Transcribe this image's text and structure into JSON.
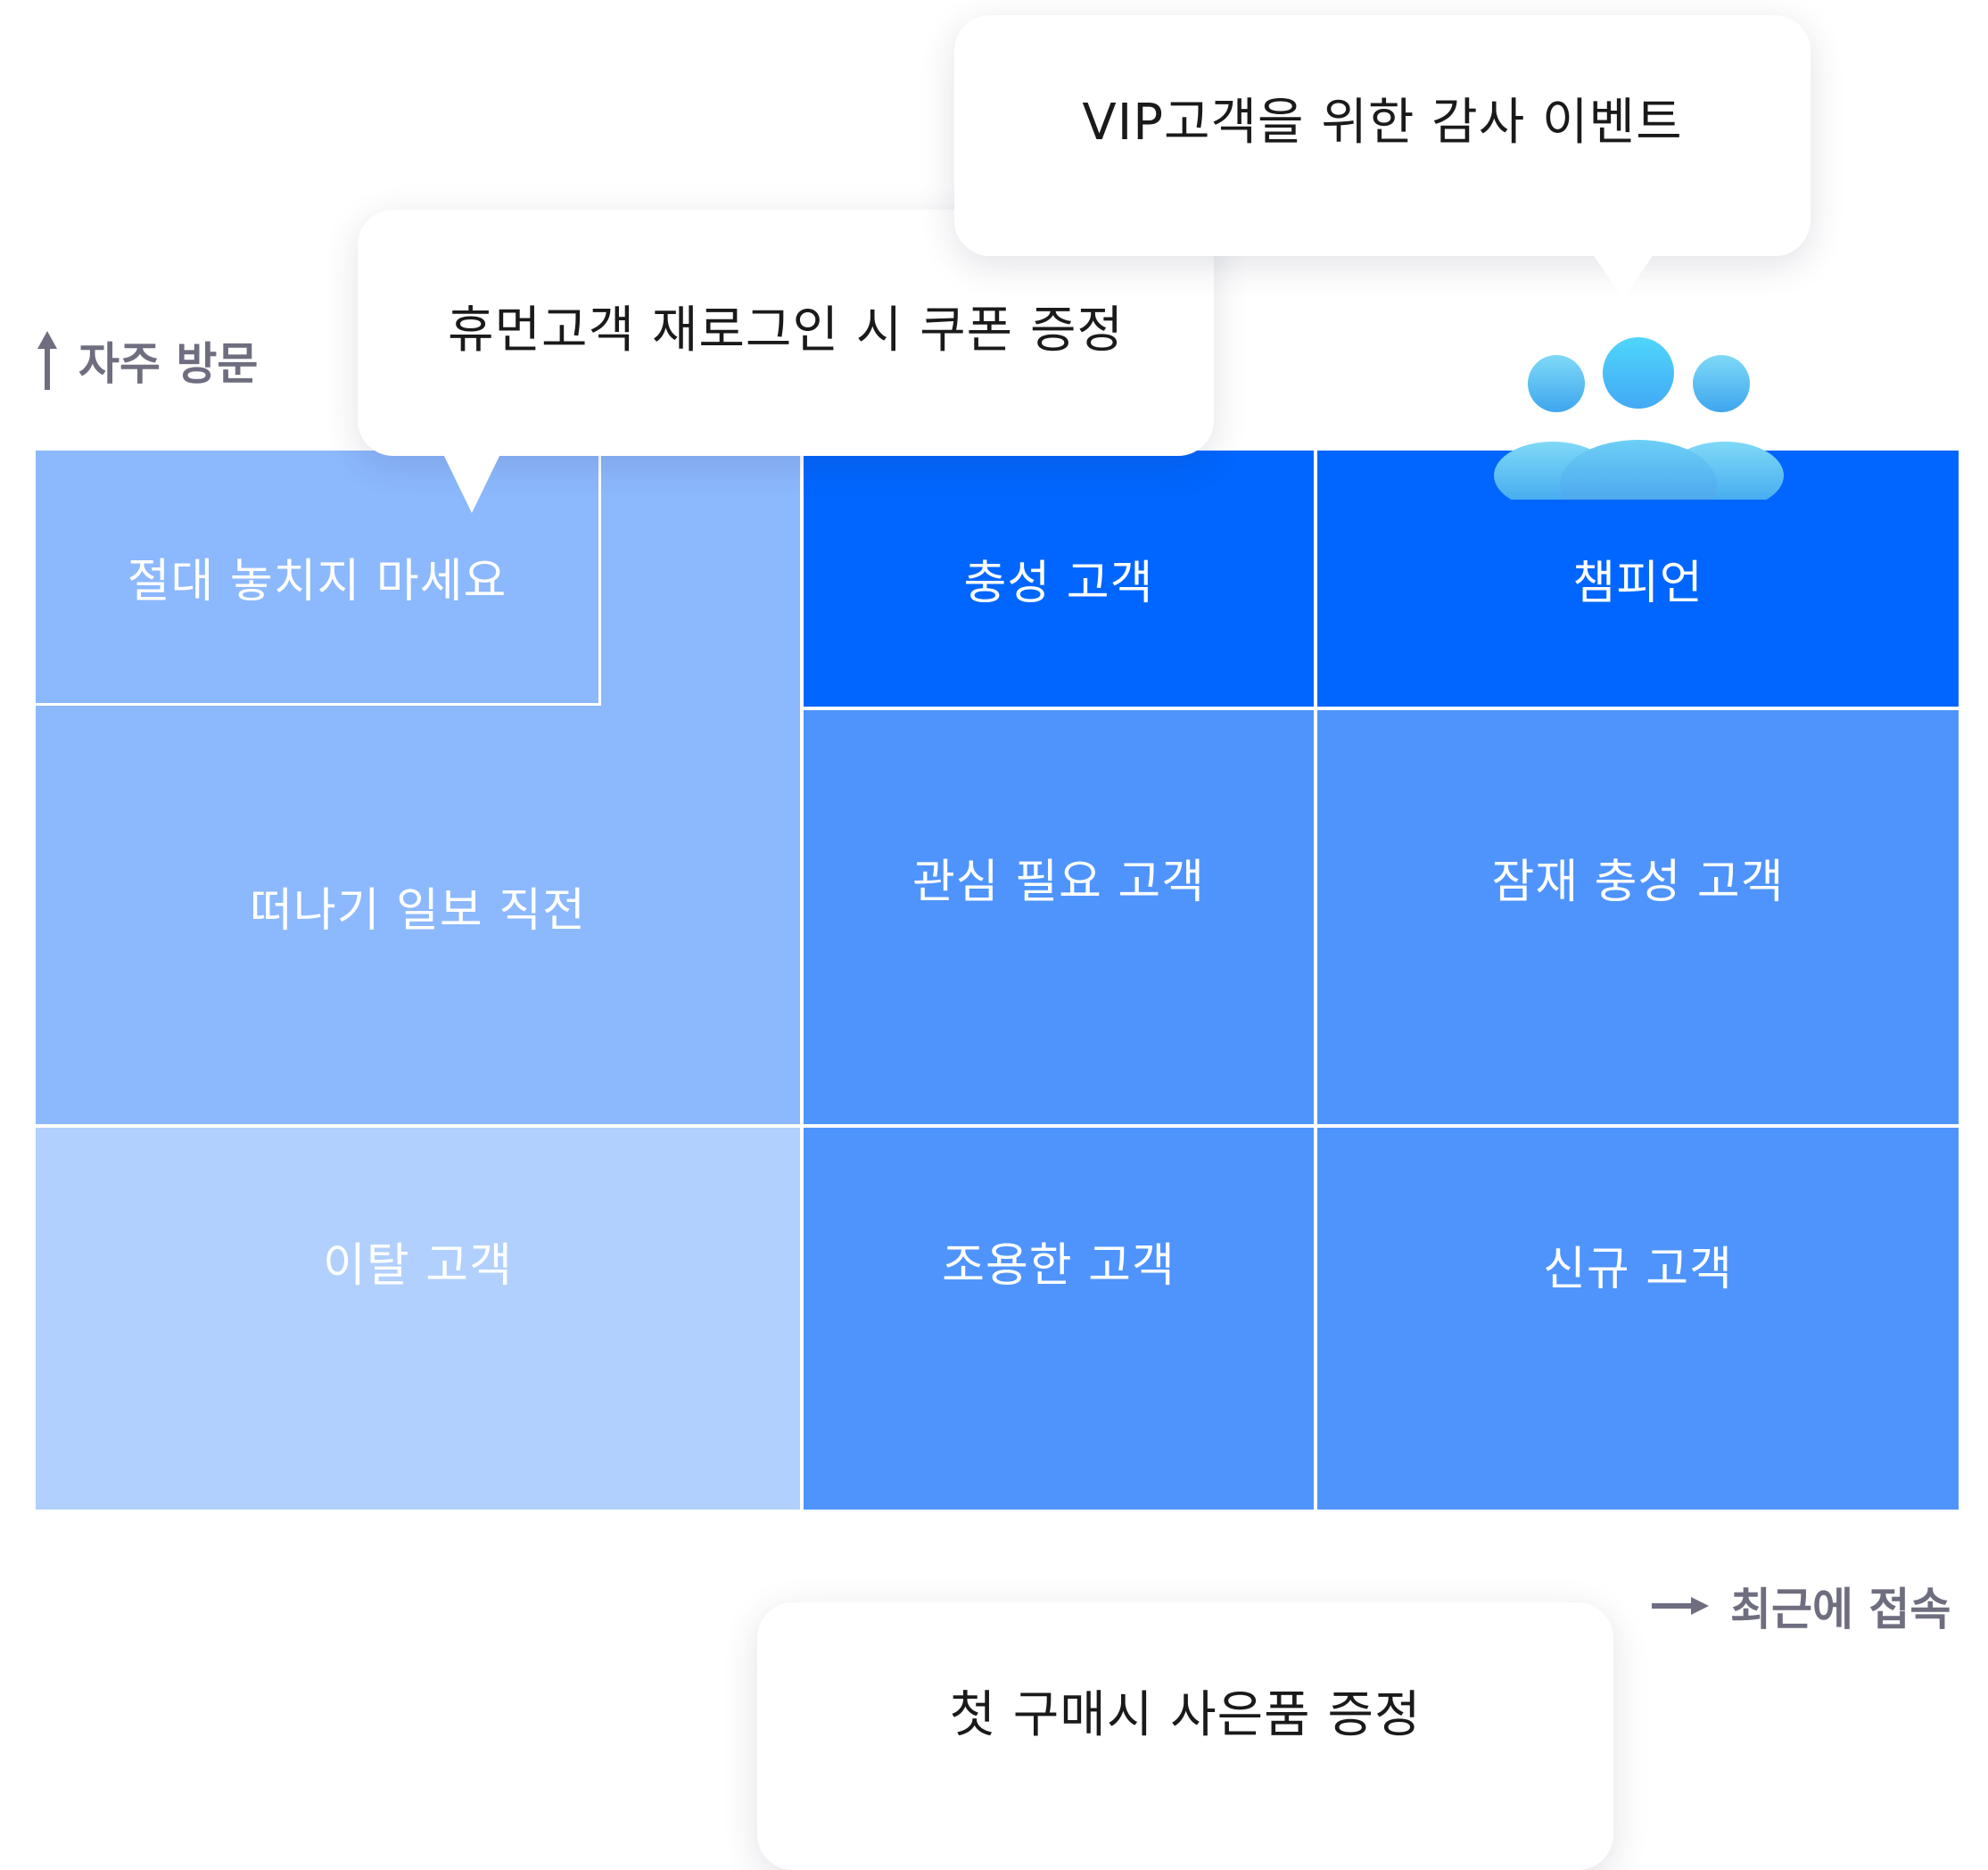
{
  "axis": {
    "y_label": "자주 방문",
    "x_label": "최근에 접속"
  },
  "segments": {
    "dont_miss": "절대 놓치지 마세요",
    "about_to_leave": "떠나기 일보 직전",
    "churned": "이탈 고객",
    "loyal": "충성 고객",
    "champion": "챔피언",
    "needs_attention": "관심 필요 고객",
    "potential_loyal": "잠재 충성 고객",
    "quiet": "조용한 고객",
    "new": "신규 고객"
  },
  "callouts": {
    "vip": "VIP고객을 위한 감사 이벤트",
    "dormant": "휴먼고객 재로그인 시 쿠폰 증정",
    "first_purchase": "첫 구매시 사은품 증정"
  },
  "icons": {
    "up_arrow": "arrow-up-icon",
    "right_arrow": "arrow-right-icon",
    "users": "users-group-icon"
  },
  "colors": {
    "light_blue": "#8cb8fd",
    "lighter_blue": "#b2d0fd",
    "medium_blue": "#4f94fd",
    "dark_blue": "#0066ff",
    "axis_gray": "#6e6e80"
  }
}
